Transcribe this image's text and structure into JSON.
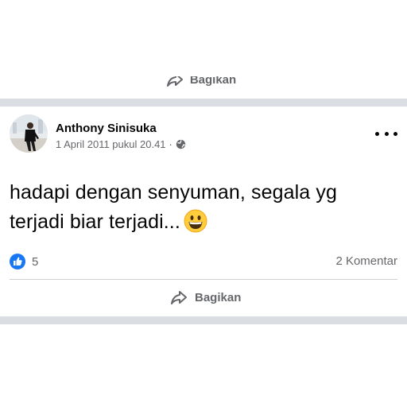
{
  "previous_post": {
    "share_label": "Bagikan"
  },
  "post": {
    "author": "Anthony Sinisuka",
    "date": "1 April 2011 pukul 20.41",
    "meta_separator": "·",
    "privacy_icon": "globe-icon",
    "more_icon": "more-options-icon",
    "text_line1": "hadapi dengan senyuman, segala yg",
    "text_line2": "terjadi biar terjadi...",
    "emoji": "grinning-face-emoji",
    "reaction_icon": "like-icon",
    "reaction_count": "5",
    "comments": "2 Komentar",
    "share_label": "Bagikan"
  },
  "colors": {
    "primary_text": "#050505",
    "secondary_text": "#65676b",
    "divider": "#dadde1",
    "like_blue": "#1877f2"
  }
}
